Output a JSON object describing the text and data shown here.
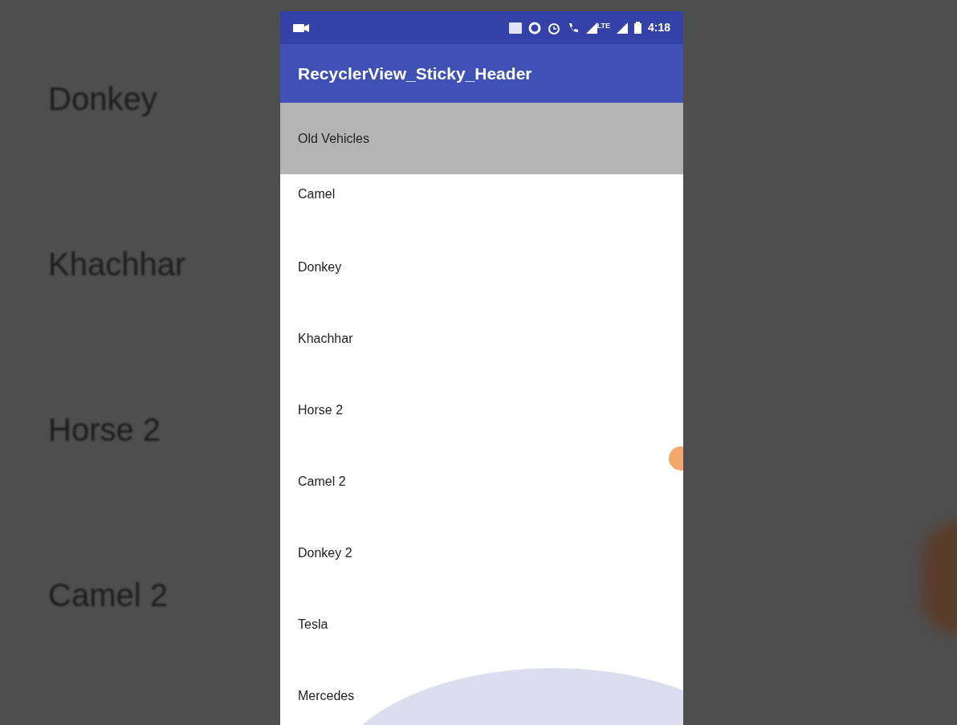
{
  "background_labels": [
    "Donkey",
    "Khachhar",
    "Horse 2",
    "Camel 2"
  ],
  "status_bar": {
    "time": "4:18",
    "network": "LTE"
  },
  "app_bar": {
    "title": "RecyclerView_Sticky_Header"
  },
  "sticky_header": {
    "title": "Old Vehicles"
  },
  "items": [
    "Camel",
    "Donkey",
    "Khachhar",
    "Horse 2",
    "Camel 2",
    "Donkey 2",
    "Tesla",
    "Mercedes"
  ]
}
